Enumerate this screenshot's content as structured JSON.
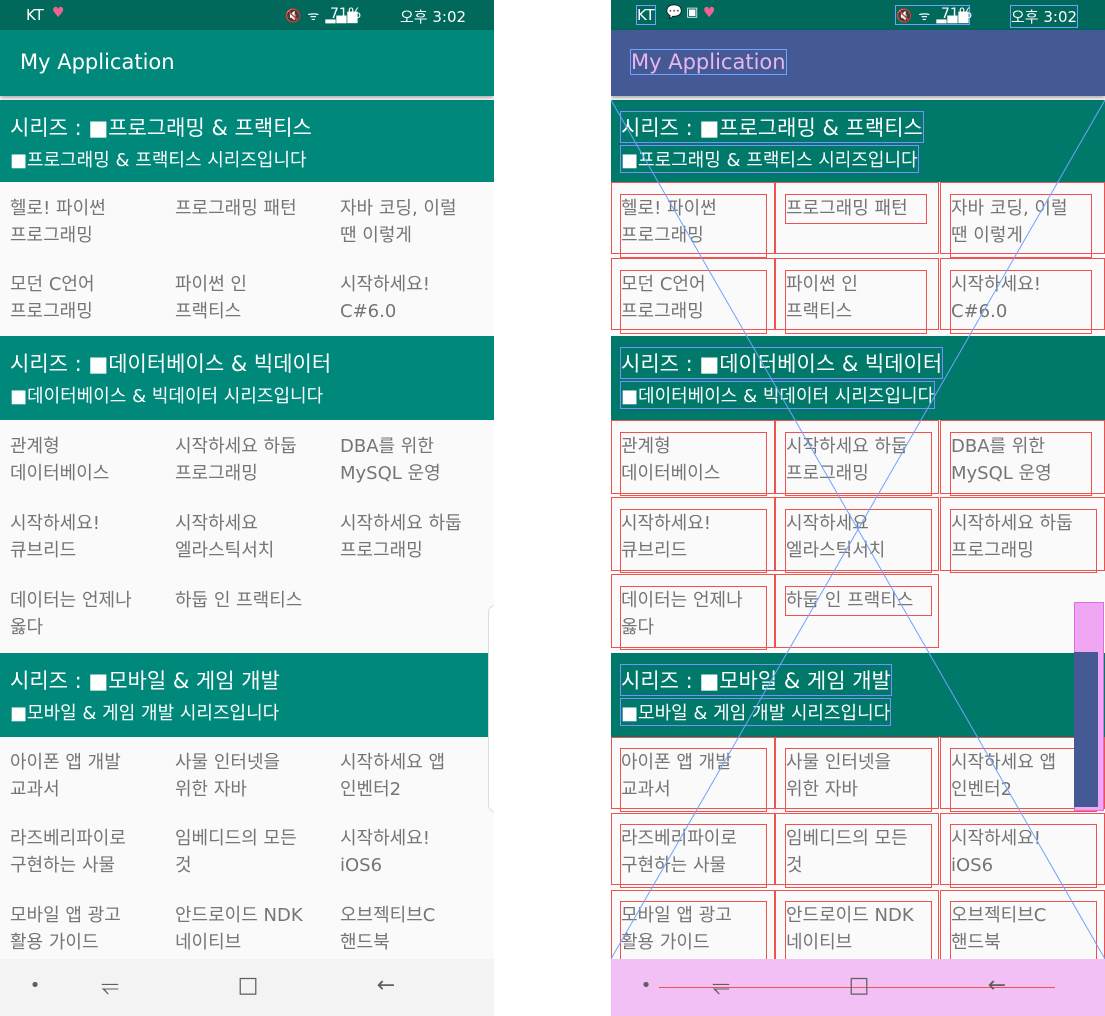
{
  "status_bar": {
    "carrier": "KT",
    "heart_icon": "heart-icon",
    "sms_icon": "chat-bubble-icon",
    "gallery_icon": "image-icon",
    "system_icons": "mute wifi signal",
    "battery": "71%",
    "time": "오후 3:02"
  },
  "app_bar": {
    "title": "My Application"
  },
  "series": [
    {
      "title": "시리즈 : ■프로그래밍 & 프랙티스",
      "subtitle": "■프로그래밍 & 프랙티스  시리즈입니다",
      "books": [
        "헬로! 파이썬\n프로그래밍",
        "프로그래밍 패턴",
        "자바 코딩, 이럴\n땐 이렇게",
        "모던 C언어\n프로그래밍",
        "파이썬 인\n프랙티스",
        "시작하세요!\nC#6.0"
      ]
    },
    {
      "title": "시리즈 : ■데이터베이스 & 빅데이터",
      "subtitle": "■데이터베이스 & 빅데이터  시리즈입니다",
      "books": [
        "관계형\n데이터베이스",
        "시작하세요 하둡\n프로그래밍",
        "DBA를 위한\nMySQL 운영",
        "시작하세요!\n큐브리드",
        "시작하세요\n엘라스틱서치",
        "시작하세요 하둡\n프로그래밍",
        "데이터는 언제나\n옳다",
        "하둡 인 프랙티스"
      ]
    },
    {
      "title": "시리즈 : ■모바일 & 게임 개발",
      "subtitle": "■모바일 & 게임 개발  시리즈입니다",
      "books": [
        "아이폰 앱 개발\n교과서",
        "사물 인터넷을\n위한 자바",
        "시작하세요 앱\n인벤터2",
        "라즈베리파이로\n구현하는 사물",
        "임베디드의 모든\n것",
        "시작하세요!\niOS6",
        "모바일 앱 광고\n활용 가이드",
        "안드로이드 NDK\n네이티브",
        "오브젝티브C\n핸드북"
      ]
    }
  ],
  "nav_bar": {
    "dot": "•",
    "recent_icon": "recent-apps-icon",
    "home_icon": "home-icon",
    "back_icon": "back-icon",
    "recent_glyph": "⥫",
    "home_glyph": "□",
    "back_glyph": "←"
  },
  "colors": {
    "status_bar": "#00695c",
    "app_bar": "#00897b",
    "series_header": "#00897b",
    "book_text": "#757575",
    "nav_bar": "#f3f3f3"
  }
}
